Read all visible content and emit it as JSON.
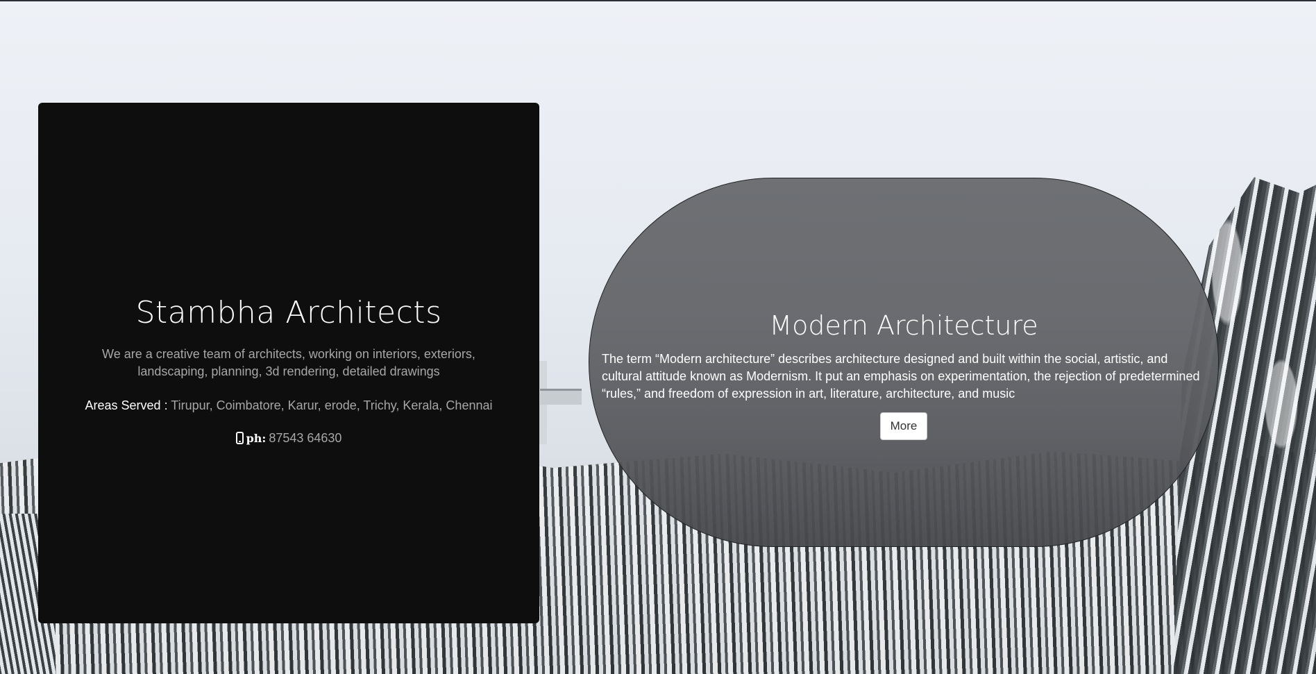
{
  "card": {
    "title": "Stambha Architects",
    "description": "We are a creative team of architects, working on interiors, exteriors, landscaping, planning, 3d rendering, detailed drawings",
    "areas_label": "Areas Served :",
    "areas_value": "Tirupur, Coimbatore, Karur, erode, Trichy, Kerala, Chennai",
    "phone_icon": "mobile-phone-icon",
    "phone_label": "ph:",
    "phone_number": "87543 64630"
  },
  "feature": {
    "title": "Modern Architecture",
    "text": "The term “Modern architecture” describes architecture designed and built within the social, artistic, and cultural attitude known as Modernism. It put an emphasis on experimentation, the rejection of predetermined “rules,” and freedom of expression in art, literature, architecture, and music",
    "button_label": "More"
  },
  "colors": {
    "card_background": "#0e0e0f",
    "muted_text": "#a7a7a7",
    "pill_background": "#6a6c70"
  }
}
